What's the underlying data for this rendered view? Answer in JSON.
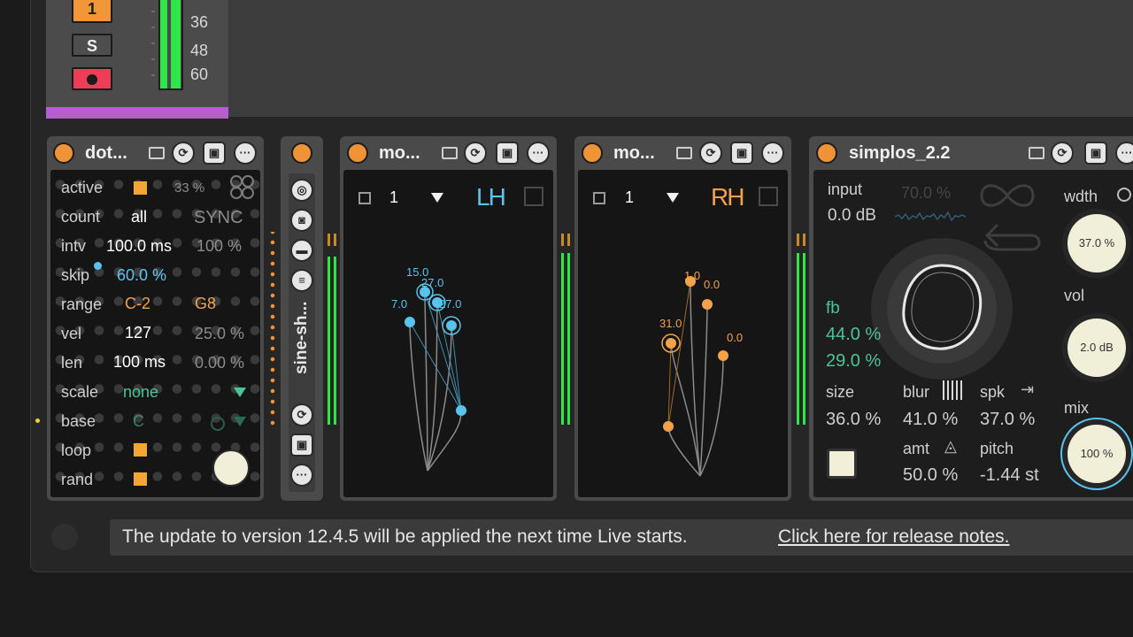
{
  "track": {
    "track_number": "1",
    "solo_label": "S",
    "arm_icon": "record-icon",
    "meter_scale": [
      "36",
      "48",
      "60"
    ]
  },
  "devices": {
    "dot": {
      "title": "dot...",
      "percent_dim": "33 %",
      "rows": {
        "active": {
          "label": "active"
        },
        "count": {
          "label": "count",
          "value": "all",
          "secondary": "SYNC"
        },
        "intv": {
          "label": "intv",
          "value": "100.0 ms",
          "secondary": "100 %"
        },
        "skip": {
          "label": "skip",
          "value": "60.0 %"
        },
        "range": {
          "label": "range",
          "value": "C-2",
          "secondary": "G8"
        },
        "vel": {
          "label": "vel",
          "value": "127",
          "secondary": "25.0 %"
        },
        "len": {
          "label": "len",
          "value": "100 ms",
          "secondary": "0.00 %"
        },
        "scale": {
          "label": "scale",
          "value": "none"
        },
        "base": {
          "label": "base",
          "value": "C"
        },
        "loop": {
          "label": "loop"
        },
        "rand": {
          "label": "rand"
        }
      }
    },
    "sine": {
      "title": "sine-sh..."
    },
    "mo_left": {
      "title": "mo...",
      "channel": "1",
      "hand": "LH",
      "points": [
        "15.0",
        "27.0",
        "7.0",
        "27.0"
      ]
    },
    "mo_right": {
      "title": "mo...",
      "channel": "1",
      "hand": "RH",
      "points": [
        "1.0",
        "0.0",
        "31.0",
        "0.0"
      ]
    },
    "simplos": {
      "title": "simplos_2.2",
      "input_label": "input",
      "input_value": "0.0 dB",
      "dim_percent": "70.0 %",
      "wdth_label": "wdth",
      "wdth_value": "37.0 %",
      "vol_label": "vol",
      "vol_value": "2.0 dB",
      "mix_label": "mix",
      "mix_value": "100 %",
      "fb_label": "fb",
      "fb_value1": "44.0 %",
      "fb_value2": "29.0 %",
      "size_label": "size",
      "size_value": "36.0 %",
      "blur_label": "blur",
      "blur_value": "41.0 %",
      "spk_label": "spk",
      "spk_value": "37.0 %",
      "amt_label": "amt",
      "amt_value": "50.0 %",
      "pitch_label": "pitch",
      "pitch_value": "-1.44 st"
    }
  },
  "notice": {
    "message": "The update to version 12.4.5 will be applied the next time Live starts.",
    "link": "Click here for release notes."
  },
  "colors": {
    "accent_orange": "#f09236",
    "meter_green": "#2ee54a",
    "track_purple": "#b55fd0",
    "lh_blue": "#59c3ee",
    "teal": "#49c597"
  }
}
